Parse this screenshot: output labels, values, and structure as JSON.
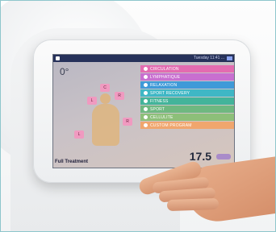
{
  "screen": {
    "status_text": "Tuesday 11:41 ...",
    "angle": "0°",
    "caption": "Full Treatment",
    "value": "17.5",
    "zones": [
      "L",
      "L",
      "C",
      "R",
      "R"
    ],
    "menu": [
      {
        "label": "CIRCULATION",
        "color": "#e36bb0"
      },
      {
        "label": "LYMPHATIQUE",
        "color": "#c86fd0"
      },
      {
        "label": "RELAXATION",
        "color": "#3f9ad8"
      },
      {
        "label": "SPORT RECOVERY",
        "color": "#3fb7c5"
      },
      {
        "label": "FITNESS",
        "color": "#43b49a"
      },
      {
        "label": "SPORT",
        "color": "#6fb880"
      },
      {
        "label": "CELLULITE",
        "color": "#8dbf79"
      },
      {
        "label": "CUSTOM PROGRAM",
        "color": "#f0a66e"
      }
    ]
  },
  "colors": {
    "frame_border": "#8ec6cc",
    "topbar": "#26315a",
    "skin": "#d9a07e"
  }
}
